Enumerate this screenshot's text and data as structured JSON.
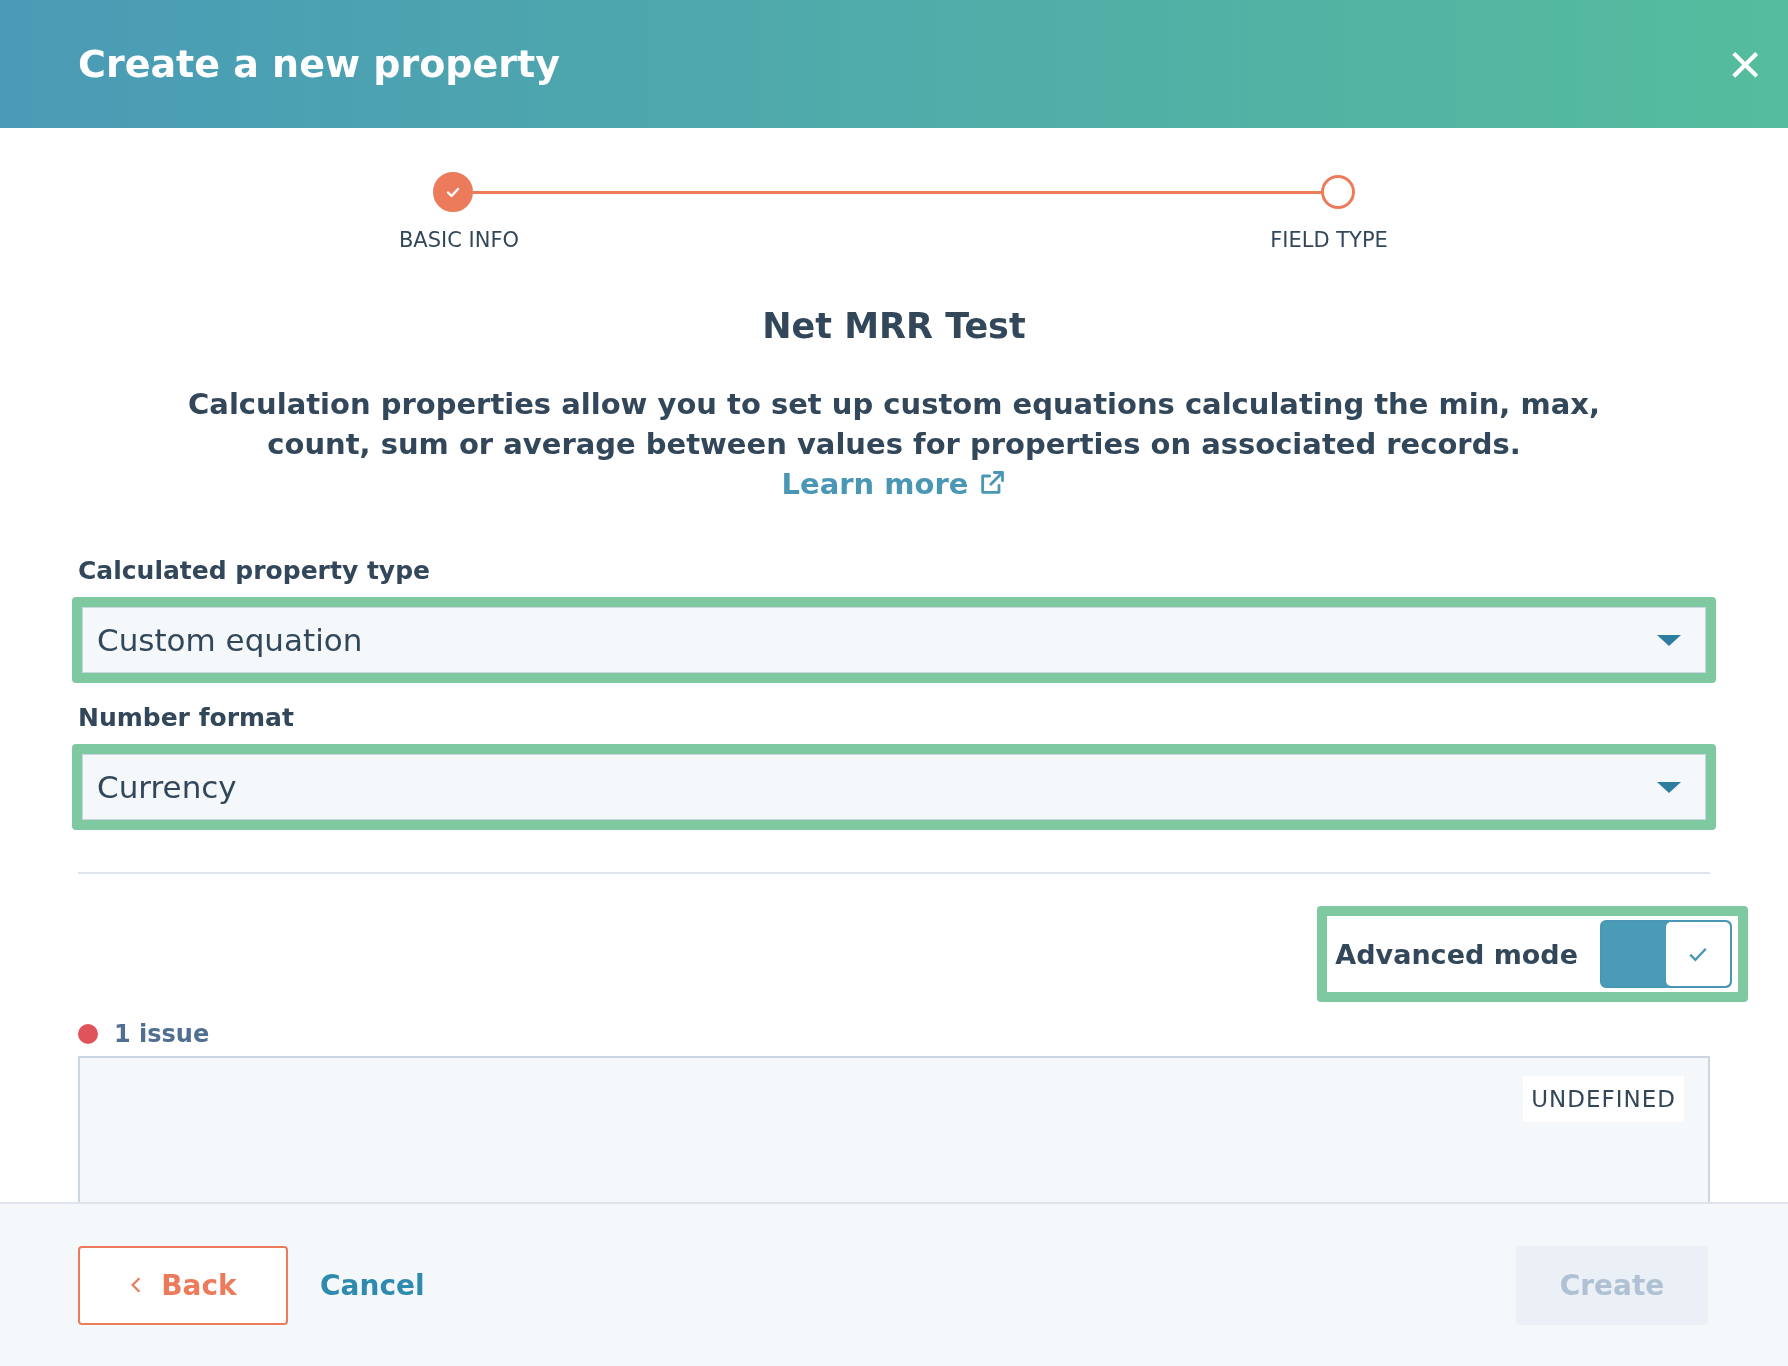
{
  "dialog": {
    "title": "Create a new property",
    "close": "×"
  },
  "steps": [
    {
      "label": "BASIC INFO",
      "completed": true
    },
    {
      "label": "FIELD TYPE",
      "completed": false
    }
  ],
  "heading": "Net MRR Test",
  "description": {
    "text": "Calculation properties allow you to set up custom equations calculating the min, max, count, sum or average between values for properties on associated records.",
    "link": "Learn more"
  },
  "fields": [
    {
      "label": "Calculated property type",
      "value": "Custom equation",
      "highlighted": true
    },
    {
      "label": "Number format",
      "value": "Currency",
      "highlighted": true
    }
  ],
  "advanced_mode": {
    "label": "Advanced mode",
    "on": true,
    "highlighted": true
  },
  "issues": {
    "count": "1 issue",
    "color": "#e0535b"
  },
  "editor": {
    "badge": "UNDEFINED"
  },
  "footer": {
    "back": "Back",
    "cancel": "Cancel",
    "create": "Create",
    "create_disabled": true
  }
}
